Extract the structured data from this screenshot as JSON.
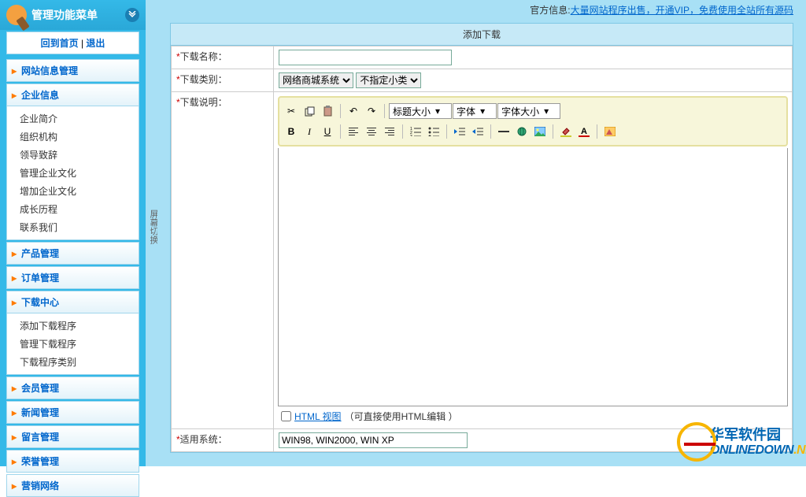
{
  "sidebar": {
    "title": "管理功能菜单",
    "nav": {
      "home": "回到首页",
      "sep": "|",
      "logout": "退出"
    },
    "groups": [
      {
        "label": "网站信息管理",
        "items": []
      },
      {
        "label": "企业信息",
        "items": [
          "企业简介",
          "组织机构",
          "领导致辞",
          "管理企业文化",
          "增加企业文化",
          "成长历程",
          "联系我们"
        ]
      },
      {
        "label": "产品管理",
        "items": []
      },
      {
        "label": "订单管理",
        "items": []
      },
      {
        "label": "下载中心",
        "items": [
          "添加下载程序",
          "管理下载程序",
          "下载程序类别"
        ]
      },
      {
        "label": "会员管理",
        "items": []
      },
      {
        "label": "新闻管理",
        "items": []
      },
      {
        "label": "留言管理",
        "items": []
      },
      {
        "label": "荣誉管理",
        "items": []
      },
      {
        "label": "营销网络",
        "items": []
      }
    ]
  },
  "screen_switch": "屏幕切换",
  "announcement": {
    "prefix": "官方信息:",
    "link": "大量网站程序出售，开通VIP，免费使用全站所有源码"
  },
  "panel": {
    "title": "添加下载",
    "fields": {
      "name_label": "下载名称：",
      "category_label": "下载类别：",
      "category_main": "网络商城系统",
      "category_sub": "不指定小类",
      "desc_label": "下载说明：",
      "system_label": "适用系统：",
      "system_value": "WIN98, WIN2000, WIN XP"
    }
  },
  "editor": {
    "heading_sel": "标题大小",
    "font_sel": "字体",
    "size_sel": "字体大小",
    "html_view": "HTML 视图",
    "html_hint": "（可直接使用HTML编辑   ）"
  },
  "watermark": {
    "cn": "华军软件园",
    "en1": "ONLINEDOWN",
    "en2": ".NET"
  }
}
